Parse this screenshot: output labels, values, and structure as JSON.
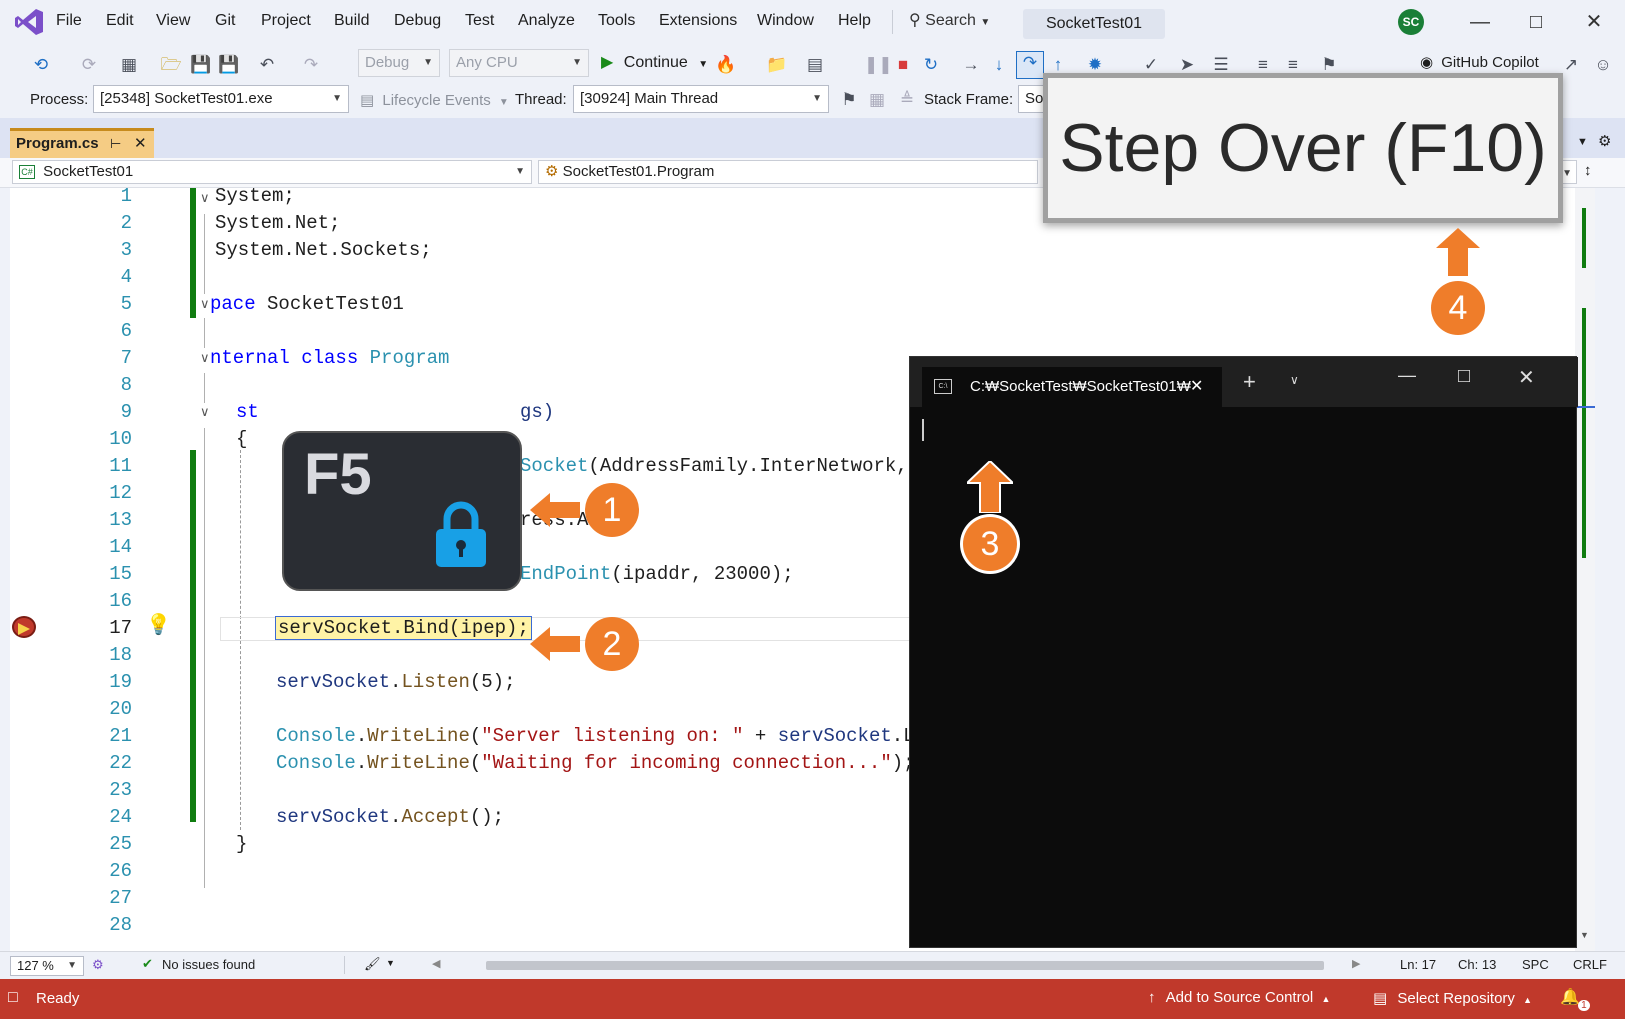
{
  "menu": {
    "items": [
      "File",
      "Edit",
      "View",
      "Git",
      "Project",
      "Build",
      "Debug",
      "Test",
      "Analyze",
      "Tools",
      "Extensions",
      "Window",
      "Help"
    ],
    "search_label": "Search",
    "solution_name": "SocketTest01",
    "avatar_initials": "SC"
  },
  "toolbar": {
    "config": "Debug",
    "platform": "Any CPU",
    "continue_label": "Continue",
    "copilot_label": "GitHub Copilot",
    "process_label": "Process:",
    "process_value": "[25348] SocketTest01.exe",
    "lifecycle_label": "Lifecycle Events",
    "thread_label": "Thread:",
    "thread_value": "[30924] Main Thread",
    "stack_frame_label": "Stack Frame:",
    "stack_frame_value": "Soc"
  },
  "tabs": {
    "active": "Program.cs"
  },
  "navbar": {
    "project": "SocketTest01",
    "type": "SocketTest01.Program"
  },
  "editor": {
    "current_line": 17,
    "line_numbers": [
      "1",
      "2",
      "3",
      "4",
      "5",
      "6",
      "7",
      "8",
      "9",
      "10",
      "11",
      "12",
      "13",
      "14",
      "15",
      "16",
      "17",
      "18",
      "19",
      "20",
      "21",
      "22",
      "23",
      "24",
      "25",
      "26",
      "27",
      "28"
    ],
    "code": {
      "l1": "System;",
      "l2": "System.Net;",
      "l3": "System.Net.Sockets;",
      "l5_kw": "pace",
      "l5_name": " SocketTest01",
      "l7_kw": "nternal class",
      "l7_name": " Program",
      "l9_start": "st",
      "l9_end": "gs)",
      "l10": "{",
      "l11_a": "Socket",
      "l11_b": "(AddressFamily.",
      "l11_c": "InterNetwork,",
      "l13": "ress.Any;",
      "l15_a": "EndPoint",
      "l15_b": "(ipaddr, 23000);",
      "l17": "servSocket.Bind(ipep);",
      "l19_a": "servSocket",
      "l19_b": ".",
      "l19_c": "Listen",
      "l19_d": "(5);",
      "l21_a": "Console",
      "l21_b": ".",
      "l21_c": "WriteLine",
      "l21_d": "(",
      "l21_e": "\"Server listening on: \"",
      "l21_f": " + ",
      "l21_g": "servSocket",
      "l21_h": ".Loca",
      "l22_a": "Console",
      "l22_b": ".",
      "l22_c": "WriteLine",
      "l22_d": "(",
      "l22_e": "\"Waiting for incoming connection...\"",
      "l22_f": ");",
      "l24_a": "servSocket",
      "l24_b": ".",
      "l24_c": "Accept",
      "l24_d": "();",
      "l25": "}"
    }
  },
  "console": {
    "title": "C:₩SocketTest₩SocketTest01₩"
  },
  "overlays": {
    "tooltip": "Step Over (F10)",
    "key": "F5",
    "badges": [
      "1",
      "2",
      "3",
      "4"
    ]
  },
  "bottom": {
    "zoom": "127 %",
    "issues": "No issues found",
    "ln": "Ln: 17",
    "ch": "Ch: 13",
    "spc": "SPC",
    "crlf": "CRLF"
  },
  "status": {
    "ready": "Ready",
    "source_control": "Add to Source Control",
    "repository": "Select Repository",
    "notifications": "1"
  },
  "colors": {
    "status_bar": "#c0392b",
    "accent_orange": "#ef7d2a",
    "change_marker": "#107c10",
    "tab_active": "#f5cc84"
  }
}
